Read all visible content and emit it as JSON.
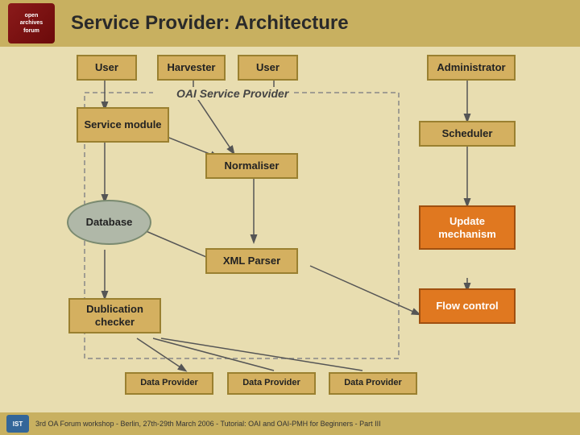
{
  "slide": {
    "title": "Service Provider: Architecture",
    "logo": {
      "line1": "open",
      "line2": "archives",
      "line3": "forum"
    },
    "components": {
      "user1": "User",
      "harvester": "Harvester",
      "user2": "User",
      "administrator": "Administrator",
      "oai_label": "OAI Service Provider",
      "service_module": "Service module",
      "normaliser": "Normaliser",
      "database": "Database",
      "xml_parser": "XML Parser",
      "duplication_checker": "Dublication checker",
      "scheduler": "Scheduler",
      "update_mechanism": "Update mechanism",
      "flow_control": "Flow control",
      "data_provider1": "Data Provider",
      "data_provider2": "Data Provider",
      "data_provider3": "Data Provider"
    },
    "footer": {
      "logo_text": "IST",
      "text": "3rd OA Forum workshop - Berlin, 27th-29th March 2006 - Tutorial: OAI and OAI-PMH for Beginners - Part III"
    }
  }
}
